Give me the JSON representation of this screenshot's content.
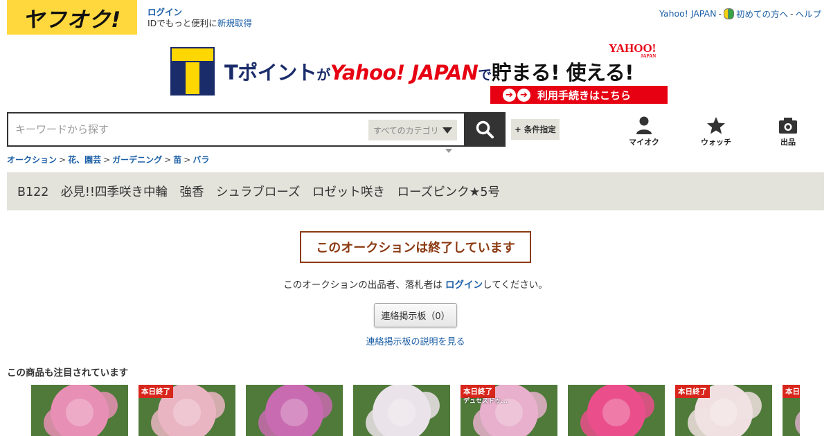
{
  "header": {
    "logo_text": "ヤフオク!",
    "login_label": "ログイン",
    "id_text": "IDでもっと便利に",
    "signup_label": "新規取得",
    "yahoo_japan_label": "Yahoo! JAPAN",
    "sep1": "-",
    "first_time_label": "初めての方へ",
    "sep2": "-",
    "help_label": "ヘルプ"
  },
  "banner": {
    "part1": "Tポイント",
    "part2": "が",
    "part3": "Yahoo! JAPAN",
    "part4": "で",
    "part5": "貯まる! 使える!",
    "yj_logo": "YAHOO!",
    "yj_logo_sub": "JAPAN",
    "cta_label": "利用手続きはこちら"
  },
  "search": {
    "placeholder": "キーワードから探す",
    "category_label": "すべてのカテゴリ",
    "advanced_label": "+ 条件指定"
  },
  "nav": {
    "my_auction": "マイオク",
    "watch": "ウォッチ",
    "sell": "出品"
  },
  "breadcrumb": [
    "オークション",
    "花、園芸",
    "ガーデニング",
    "苗",
    "バラ"
  ],
  "breadcrumb_sep": ">",
  "item": {
    "title": "B122　必見!!四季咲き中輪　強香　シュラブローズ　ロゼット咲き　ローズピンク★5号"
  },
  "status": {
    "ended_label": "このオークションは終了しています",
    "login_msg_before": "このオークションの出品者、落札者は ",
    "login_msg_link": "ログイン",
    "login_msg_after": "してください。",
    "board_button": "連絡掲示板（0）",
    "board_help_link": "連絡掲示板の説明を見る"
  },
  "recommend": {
    "title": "この商品も注目されています",
    "thumbs": [
      {
        "badge": "",
        "overlay": "",
        "color": "#e88fb5"
      },
      {
        "badge": "本日終了",
        "overlay": "",
        "color": "#eab5c3"
      },
      {
        "badge": "",
        "overlay": "",
        "color": "#c86bb0"
      },
      {
        "badge": "",
        "overlay": "",
        "color": "#ebe3ea"
      },
      {
        "badge": "本日終了",
        "overlay": "デュセスドゥ...",
        "color": "#e8b0cc"
      },
      {
        "badge": "",
        "overlay": "",
        "color": "#ea4f8c"
      },
      {
        "badge": "本日終了",
        "overlay": "",
        "color": "#f0e0e2"
      },
      {
        "badge": "本日終了",
        "overlay": "",
        "color": "#d8aec8"
      }
    ]
  }
}
